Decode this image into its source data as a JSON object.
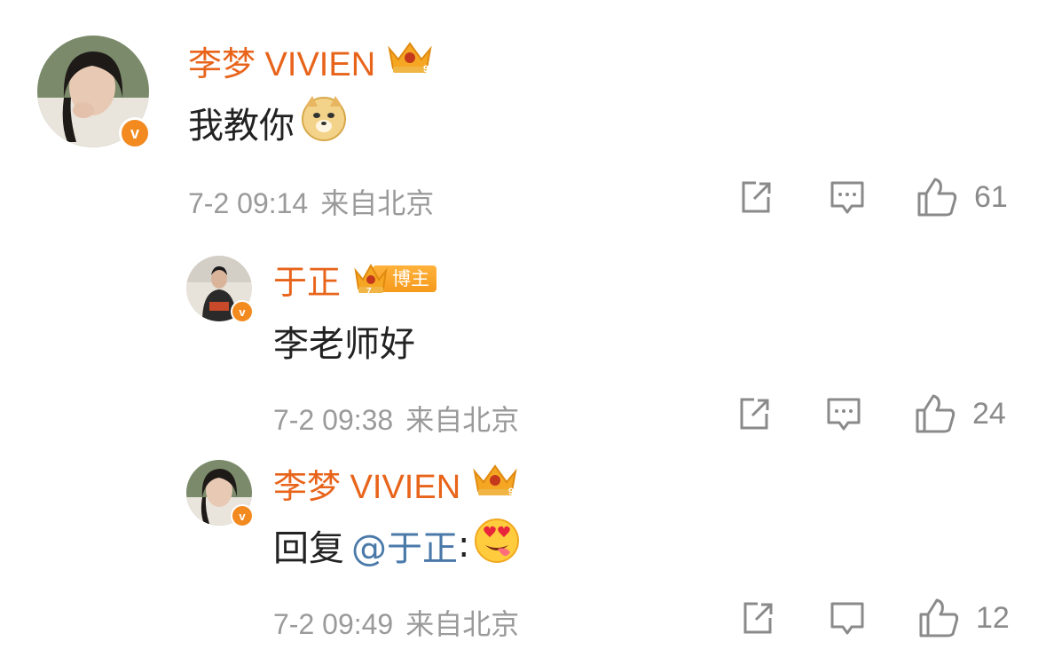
{
  "comments": [
    {
      "username": "李梦 VIVIEN",
      "text": "我教你",
      "emoji": "doge-emoji",
      "time": "7-2 09:14",
      "location": "来自北京",
      "likes": "61"
    },
    {
      "username": "于正",
      "badge_label": "博主",
      "text": "李老师好",
      "time": "7-2 09:38",
      "location": "来自北京",
      "likes": "24"
    },
    {
      "username": "李梦 VIVIEN",
      "reply_prefix": "回复",
      "mention": "@于正",
      "reply_colon": ":",
      "emoji": "heart-eyes-tongue-emoji",
      "time": "7-2 09:49",
      "location": "来自北京",
      "likes": "12"
    }
  ],
  "colors": {
    "username": "#e8641b",
    "verified": "#f28a20",
    "meta": "#9a9a9a",
    "mention": "#4a79a9"
  },
  "icons": [
    "share-icon",
    "reply-icon",
    "like-icon",
    "verified-icon",
    "crown-icon"
  ]
}
